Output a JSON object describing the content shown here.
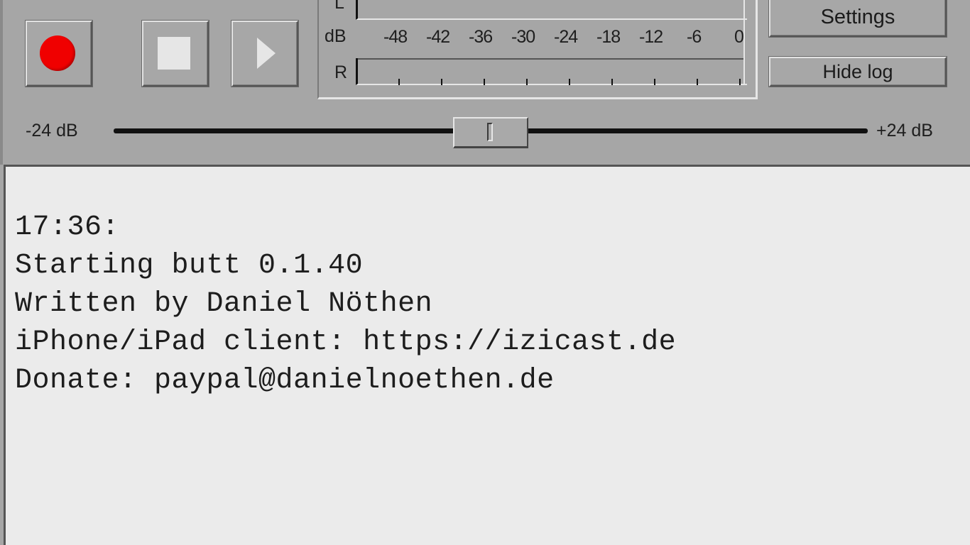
{
  "transport": {
    "record_icon": "record-icon",
    "stop_icon": "stop-icon",
    "play_icon": "play-icon"
  },
  "vu_meter": {
    "left_channel_label": "L",
    "unit_label": "dB",
    "right_channel_label": "R",
    "scale": [
      "-48",
      "-42",
      "-36",
      "-30",
      "-24",
      "-18",
      "-12",
      "-6",
      "0"
    ]
  },
  "buttons": {
    "settings_label": "Settings",
    "hide_log_label": "Hide log"
  },
  "gain": {
    "min_label": "-24 dB",
    "max_label": "+24 dB",
    "value_fraction": 0.5
  },
  "log": {
    "lines": [
      "17:36:",
      "Starting butt 0.1.40",
      "Written by Daniel Nöthen",
      "iPhone/iPad client: https://izicast.de",
      "Donate: paypal@danielnoethen.de"
    ]
  },
  "colors": {
    "record": "#f00000",
    "panel": "#a6a6a6",
    "log_background": "#ebebeb"
  }
}
